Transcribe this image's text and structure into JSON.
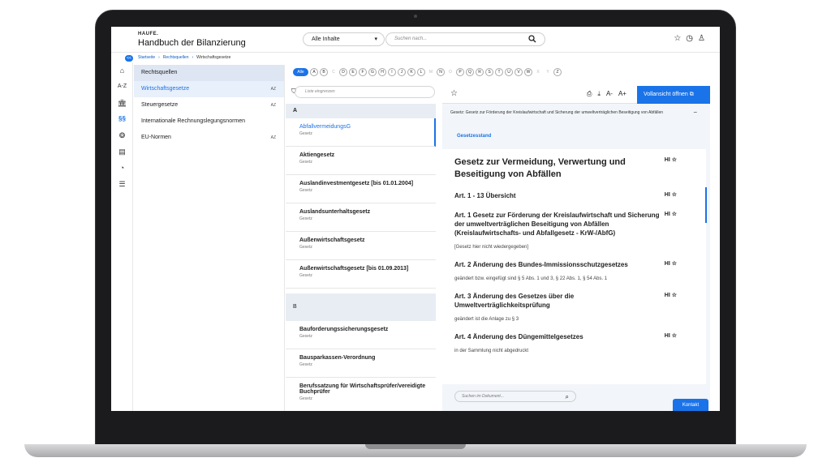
{
  "header": {
    "brand": "HAUFE.",
    "title": "Handbuch der Bilanzierung",
    "select_value": "Alle Inhalte",
    "search_placeholder": "Suchen nach..."
  },
  "breadcrumb": [
    "Startseite",
    "Rechtsquellen",
    "Wirtschaftsgesetze"
  ],
  "breadcrumb_toggle": "<<",
  "nav": {
    "heading": "Rechtsquellen",
    "items": [
      {
        "label": "Wirtschaftsgesetze",
        "az": "AZ"
      },
      {
        "label": "Steuergesetze",
        "az": "AZ"
      },
      {
        "label": "Internationale Rechnungslegungsnormen",
        "az": ""
      },
      {
        "label": "EU-Normen",
        "az": "AZ"
      }
    ]
  },
  "alpha": {
    "all": "Alle",
    "letters": [
      "A",
      "B",
      "C",
      "D",
      "E",
      "F",
      "G",
      "H",
      "I",
      "J",
      "K",
      "L",
      "M",
      "N",
      "O",
      "P",
      "Q",
      "R",
      "S",
      "T",
      "U",
      "V",
      "W",
      "X",
      "Y",
      "Z"
    ],
    "disabled": [
      "C",
      "M",
      "O",
      "X",
      "Y"
    ]
  },
  "filter_placeholder": "Liste eingrenzen",
  "list": {
    "group_a": "A",
    "group_b": "B",
    "items_a": [
      {
        "name": "AbfallvermeidungsG",
        "sub": "Gesetz"
      },
      {
        "name": "Aktiengesetz",
        "sub": "Gesetz"
      },
      {
        "name": "Auslandinvestmentgesetz [bis 01.01.2004]",
        "sub": "Gesetz"
      },
      {
        "name": "Auslandsunterhaltsgesetz",
        "sub": "Gesetz"
      },
      {
        "name": "Außenwirtschaftsgesetz",
        "sub": "Gesetz"
      },
      {
        "name": "Außenwirtschaftsgesetz [bis 01.09.2013]",
        "sub": "Gesetz"
      }
    ],
    "items_b": [
      {
        "name": "Bauforderungssicherungsgesetz",
        "sub": "Gesetz"
      },
      {
        "name": "Bausparkassen-Verordnung",
        "sub": "Gesetz"
      },
      {
        "name": "Berufssatzung für Wirtschaftsprüfer/vereidigte Buchprüfer",
        "sub": "Gesetz"
      }
    ]
  },
  "doc": {
    "open_button": "Vollansicht öffnen",
    "subtitle": "Gesetz: Gesetz zur Förderung der Kreislaufwirtschaft und Sicherung der umweltverträglichen Beseitigung von Abfällen",
    "tab": "Gesetzesstand",
    "title": "Gesetz zur Vermeidung, Verwertung und Beseitigung von Abfällen",
    "hi": "HI",
    "articles": [
      {
        "title": "Art. 1 - 13 Übersicht",
        "note": ""
      },
      {
        "title": "Art. 1 Gesetz zur Förderung der Kreislaufwirtschaft und Sicherung der umweltverträglichen Beseitigung von Abfällen (Kreislaufwirtschafts- und Abfallgesetz - KrW-/AbfG)",
        "note": "[Gesetz hier nicht wiedergegeben]"
      },
      {
        "title": "Art. 2 Änderung des Bundes-Immissionsschutzgesetzes",
        "note": "geändert bzw. eingefügt sind § 5 Abs. 1 und 3, § 22 Abs. 1, § 54 Abs. 1"
      },
      {
        "title": "Art. 3 Änderung des Gesetzes über die Umweltverträglichkeitsprüfung",
        "note": "geändert ist die Anlage zu § 3"
      },
      {
        "title": "Art. 4 Änderung des Düngemittelgesetzes",
        "note": "in der Sammlung nicht abgedruckt"
      }
    ],
    "search_placeholder": "Suchen im Dokument..."
  },
  "kontakt": "Kontakt"
}
